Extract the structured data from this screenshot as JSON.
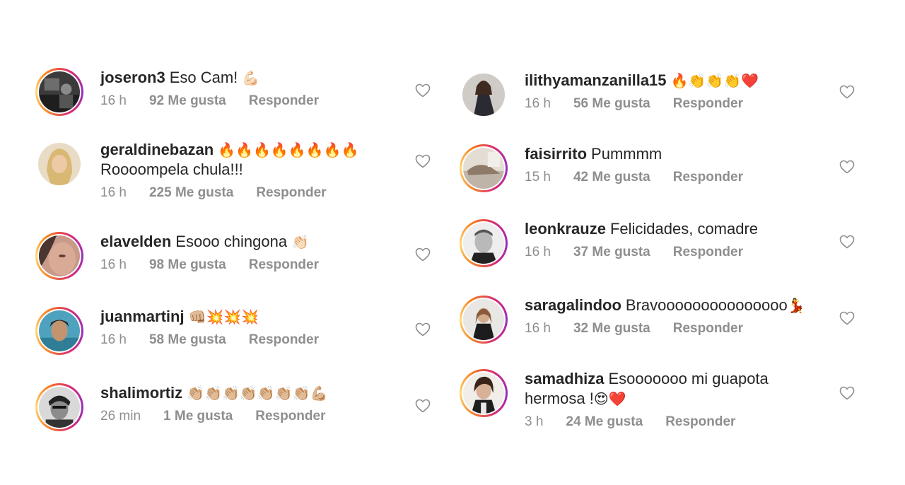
{
  "left_comments": [
    {
      "username": "joseron3",
      "text": "Eso Cam!",
      "emoji": "💪🏻",
      "time": "16 h",
      "likes": "92 Me gusta",
      "reply": "Responder"
    },
    {
      "username": "geraldinebazan",
      "text": "",
      "emoji": "🔥🔥🔥🔥🔥🔥🔥🔥",
      "line2": "Roooompela chula!!!",
      "time": "16 h",
      "likes": "225 Me gusta",
      "reply": "Responder"
    },
    {
      "username": "elavelden",
      "text": "Esooo chingona",
      "emoji": "👏🏻",
      "time": "16 h",
      "likes": "98 Me gusta",
      "reply": "Responder"
    },
    {
      "username": "juanmartinj",
      "text": "",
      "emoji": "👊🏼💥💥💥",
      "time": "16 h",
      "likes": "58 Me gusta",
      "reply": "Responder"
    },
    {
      "username": "shalimortiz",
      "text": "",
      "emoji": "👏🏼👏🏼👏🏼👏🏼👏🏼👏🏼👏🏼💪🏼",
      "time": "26 min",
      "likes": "1 Me gusta",
      "reply": "Responder"
    }
  ],
  "right_comments": [
    {
      "username": "ilithyamanzanilla15",
      "text": "",
      "emoji": "🔥👏👏👏❤️",
      "time": "16 h",
      "likes": "56 Me gusta",
      "reply": "Responder"
    },
    {
      "username": "faisirrito",
      "text": "Pummmm",
      "emoji": "",
      "time": "15 h",
      "likes": "42 Me gusta",
      "reply": "Responder"
    },
    {
      "username": "leonkrauze",
      "text": "Felicidades, comadre",
      "emoji": "",
      "time": "16 h",
      "likes": "37 Me gusta",
      "reply": "Responder"
    },
    {
      "username": "saragalindoo",
      "text": "Bravooooooooooooooo",
      "emoji": "💃",
      "time": "16 h",
      "likes": "32 Me gusta",
      "reply": "Responder"
    },
    {
      "username": "samadhiza",
      "text": "Esooooooo mi guapota",
      "emoji": "",
      "line2": "hermosa !",
      "line2_emoji": "😍❤️",
      "time": "3 h",
      "likes": "24 Me gusta",
      "reply": "Responder"
    }
  ]
}
